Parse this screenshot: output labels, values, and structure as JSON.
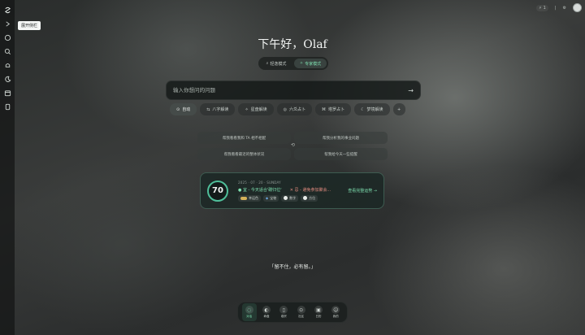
{
  "sidebar": {
    "icons": [
      "logo-icon",
      "expand-icon",
      "chat-icon",
      "search-icon",
      "bell-icon",
      "moon-icon",
      "calendar-icon",
      "book-icon"
    ],
    "tooltip": "展开侧栏"
  },
  "topbar": {
    "points": "1",
    "badge": "⚡",
    "settings_icon": "gear-icon"
  },
  "greeting": "下午好，Olaf",
  "modes": [
    {
      "label": "轻逸模式",
      "icon": "search-icon",
      "active": false
    },
    {
      "label": "专家模式",
      "icon": "sparkle-icon",
      "active": true
    }
  ],
  "search": {
    "placeholder": "输入你想问的问题"
  },
  "chips": [
    {
      "label": "自动",
      "icon": "auto-icon",
      "active": true
    },
    {
      "label": "八字解读",
      "icon": "bazi-icon",
      "active": false
    },
    {
      "label": "星盘解读",
      "icon": "star-icon",
      "active": false
    },
    {
      "label": "六爻占卜",
      "icon": "coin-icon",
      "active": false
    },
    {
      "label": "塔罗占卜",
      "icon": "tarot-icon",
      "active": false
    },
    {
      "label": "梦境解读",
      "icon": "moon-icon",
      "active": false
    },
    {
      "label": "+",
      "icon": "plus-icon",
      "active": false
    }
  ],
  "suggestions": {
    "left": [
      "帮我看看我和 TA 相不相配",
      "帮我看看最近的整体状况"
    ],
    "right": [
      "帮我分析我的事业问题",
      "帮我给今天一些提醒"
    ],
    "refresh": "⟲"
  },
  "fortune": {
    "score": "70",
    "date": "2025 · 07 · 20 · SUNDAY",
    "good": "● 宜 - 今天适合'碳归位'",
    "bad": "✕ 忌 - 避免参加聚会...",
    "tags": [
      {
        "label": "幸运色",
        "color": "#d6b25a"
      },
      {
        "label": "宝物",
        "color": "#6aa8e0"
      },
      {
        "label": "数字",
        "color": "#e8ece9"
      },
      {
        "label": "方位",
        "color": "#e8ece9"
      }
    ],
    "link": "查看完整运势 →"
  },
  "quote": "「留不住，必有留。」",
  "dock": [
    {
      "label": "对话",
      "icon": "chat-icon",
      "active": true
    },
    {
      "label": "命盘",
      "icon": "chart-icon",
      "active": false
    },
    {
      "label": "卷宗",
      "icon": "book-icon",
      "active": false
    },
    {
      "label": "社区",
      "icon": "compass-icon",
      "active": false
    },
    {
      "label": "日历",
      "icon": "calendar-icon",
      "active": false
    },
    {
      "label": "我的",
      "icon": "user-icon",
      "active": false
    }
  ],
  "accent": "#7ee0b0"
}
